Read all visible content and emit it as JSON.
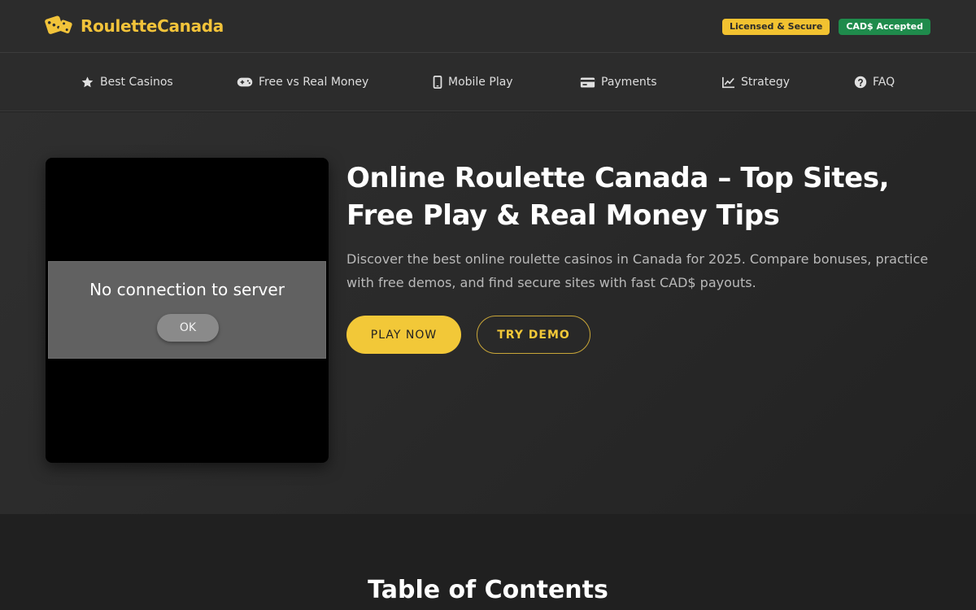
{
  "header": {
    "logo_text": "RouletteCanada",
    "logo_icon": "dice-icon",
    "badges": [
      {
        "label": "Licensed & Secure",
        "color": "#f2c230"
      },
      {
        "label": "CAD$ Accepted",
        "color": "#1f8b4c"
      }
    ]
  },
  "nav": {
    "items": [
      {
        "label": "Best Casinos",
        "icon": "star-icon"
      },
      {
        "label": "Free vs Real Money",
        "icon": "gamepad-icon"
      },
      {
        "label": "Mobile Play",
        "icon": "mobile-icon"
      },
      {
        "label": "Payments",
        "icon": "credit-card-icon"
      },
      {
        "label": "Strategy",
        "icon": "chart-line-icon"
      },
      {
        "label": "FAQ",
        "icon": "question-circle-icon"
      }
    ]
  },
  "hero": {
    "title": "Online Roulette Canada – Top Sites, Free Play & Real Money Tips",
    "description": "Discover the best online roulette casinos in Canada for 2025. Compare bonuses, practice with free demos, and find secure sites with fast CAD$ payouts.",
    "play_button": "PLAY NOW",
    "demo_button": "TRY DEMO",
    "player": {
      "dialog_message": "No connection to server",
      "dialog_ok": "OK"
    }
  },
  "toc": {
    "title": "Table of Contents"
  },
  "colors": {
    "accent": "#f2c838",
    "background": "#222222",
    "header_bg": "#2c2c2c",
    "success": "#1f8b4c"
  }
}
